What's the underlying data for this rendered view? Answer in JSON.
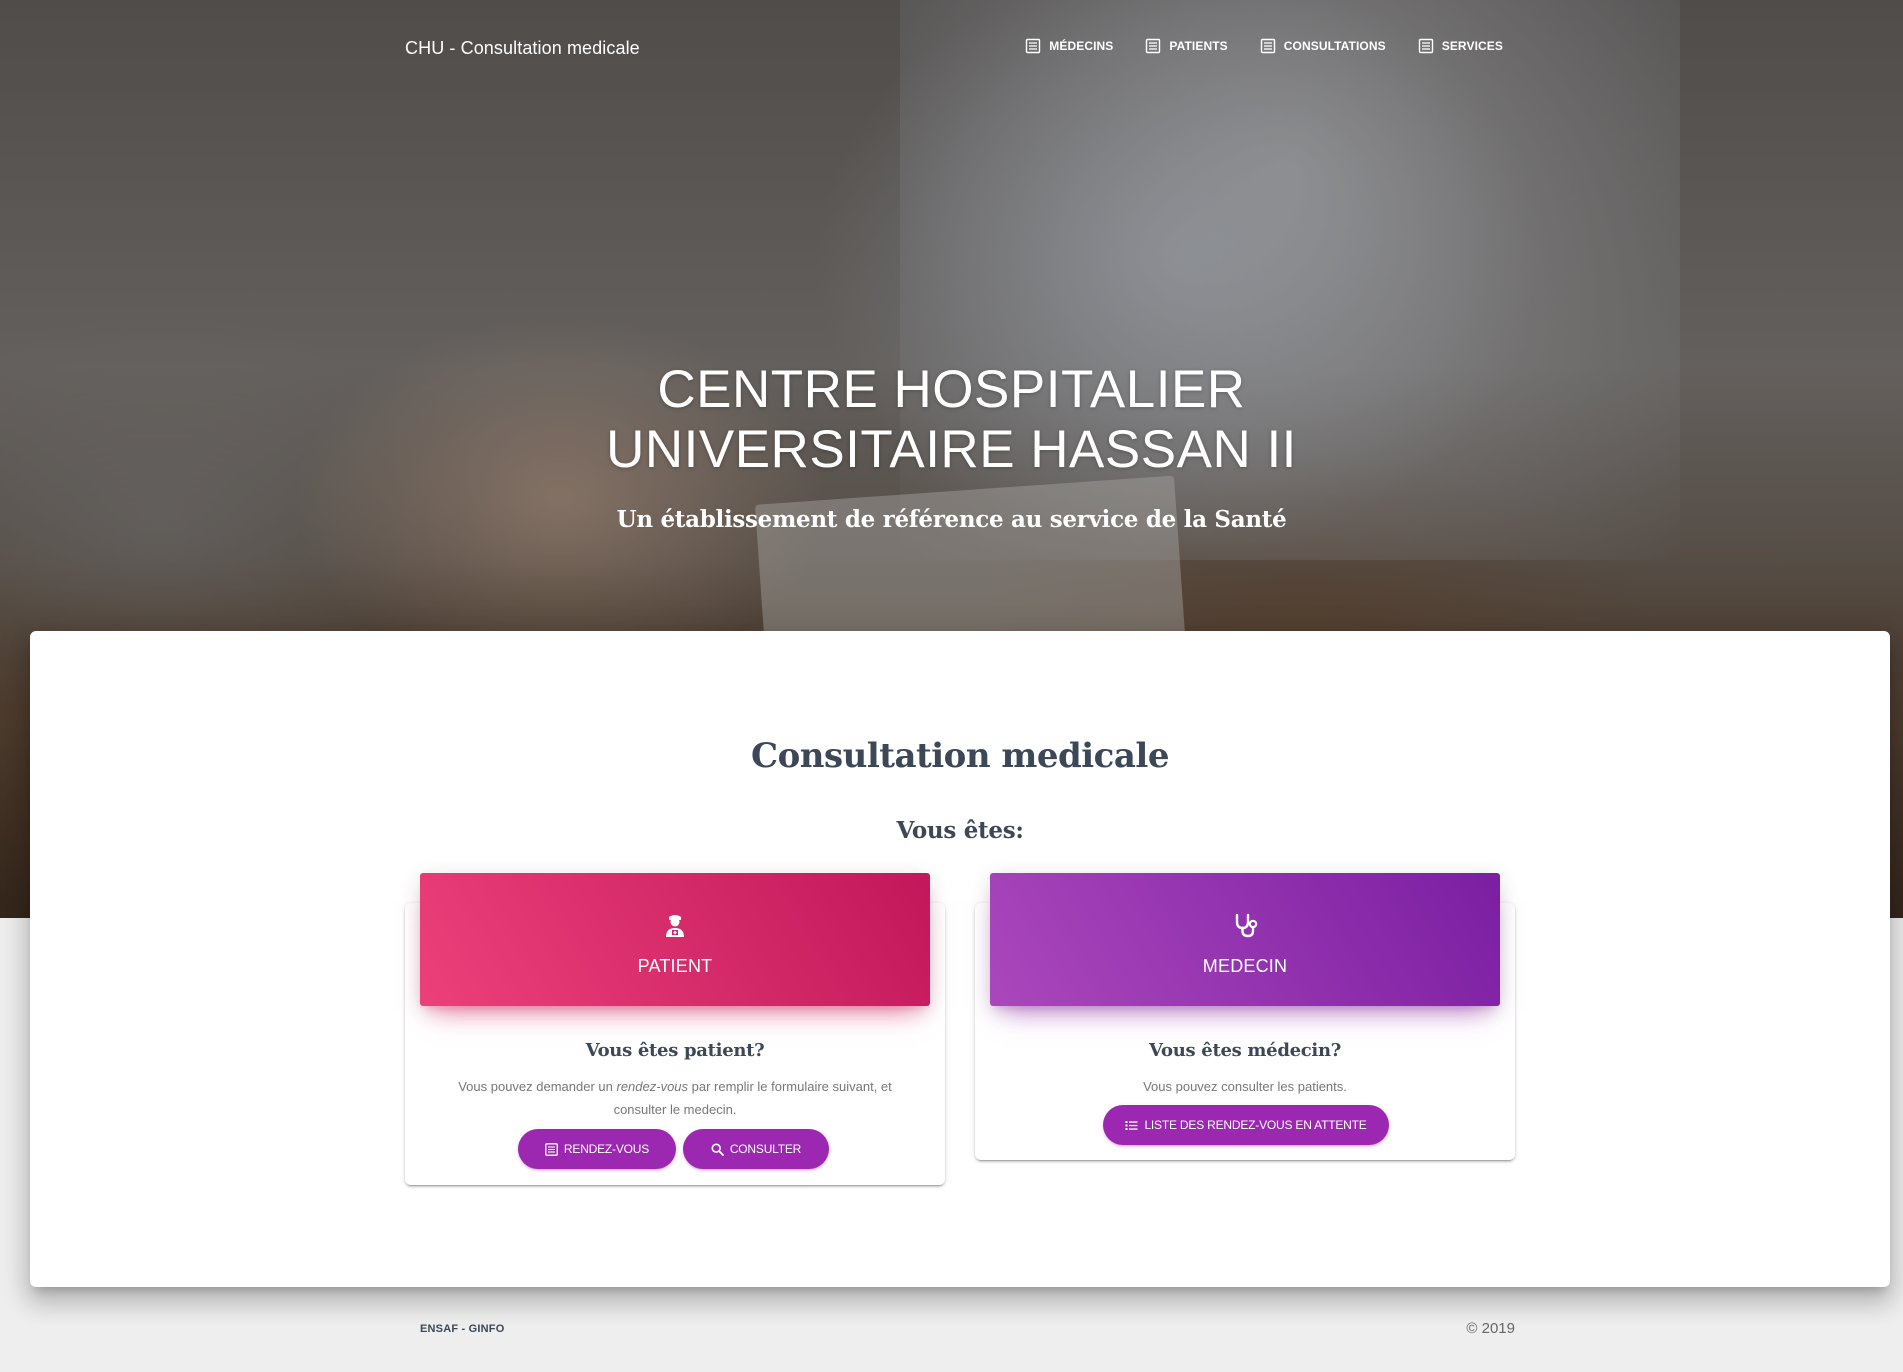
{
  "navbar": {
    "brand": "CHU - Consultation medicale",
    "items": [
      {
        "label": "MÉDECINS",
        "icon": "list-icon"
      },
      {
        "label": "PATIENTS",
        "icon": "list-icon"
      },
      {
        "label": "CONSULTATIONS",
        "icon": "list-icon"
      },
      {
        "label": "SERVICES",
        "icon": "list-icon"
      }
    ]
  },
  "hero": {
    "title_line1": "CENTRE HOSPITALIER",
    "title_line2": "UNIVERSITAIRE HASSAN II",
    "subtitle": "Un établissement de référence au service de la Santé"
  },
  "main": {
    "title": "Consultation medicale",
    "subtitle": "Vous êtes:"
  },
  "patient_card": {
    "label": "PATIENT",
    "icon": "user-doctor-icon",
    "question": "Vous êtes patient?",
    "desc_before": "Vous pouvez demander un ",
    "desc_em": "rendez-vous",
    "desc_after": " par remplir le formulaire suivant, et consulter le medecin.",
    "btn_rdv": "RENDEZ-VOUS",
    "btn_consulter": "CONSULTER"
  },
  "medecin_card": {
    "label": "MEDECIN",
    "icon": "stethoscope-icon",
    "question": "Vous êtes médecin?",
    "desc": "Vous pouvez consulter les patients.",
    "btn_liste": "LISTE DES RENDEZ-VOUS EN ATTENTE"
  },
  "footer": {
    "left": "ENSAF - GINFO",
    "right": "© 2019"
  },
  "colors": {
    "patient_start": "#ec407a",
    "patient_end": "#c2185b",
    "medecin_start": "#ab47bc",
    "medecin_end": "#7b1fa2",
    "button": "#9c27b0",
    "heading": "#3c4858"
  }
}
